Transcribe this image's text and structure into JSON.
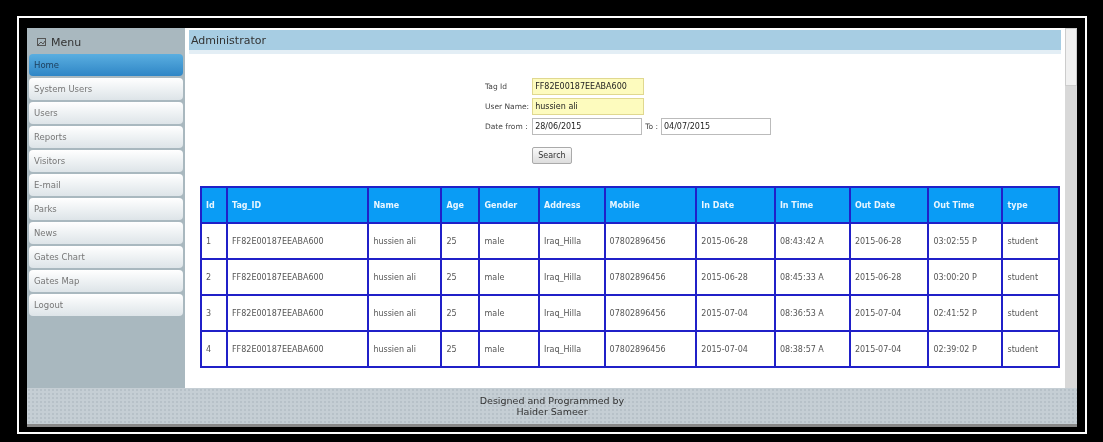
{
  "sidebar": {
    "title": "Menu",
    "items": [
      {
        "label": "Home",
        "selected": true
      },
      {
        "label": "System Users",
        "selected": false
      },
      {
        "label": "Users",
        "selected": false
      },
      {
        "label": "Reports",
        "selected": false
      },
      {
        "label": "Visitors",
        "selected": false
      },
      {
        "label": "E-mail",
        "selected": false
      },
      {
        "label": "Parks",
        "selected": false
      },
      {
        "label": "News",
        "selected": false
      },
      {
        "label": "Gates Chart",
        "selected": false
      },
      {
        "label": "Gates Map",
        "selected": false
      },
      {
        "label": "Logout",
        "selected": false
      }
    ]
  },
  "header": {
    "title": "Administrator"
  },
  "form": {
    "tag_id": {
      "label": "Tag Id",
      "value": "FF82E00187EEABA600"
    },
    "user_name": {
      "label": "User Name:",
      "value": "hussien ali"
    },
    "date_from": {
      "label": "Date from :",
      "value": "28/06/2015"
    },
    "date_to": {
      "label": "To :",
      "value": "04/07/2015"
    },
    "search_button": "Search"
  },
  "table": {
    "columns": [
      "Id",
      "Tag_ID",
      "Name",
      "Age",
      "Gender",
      "Address",
      "Mobile",
      "In Date",
      "In Time",
      "Out Date",
      "Out Time",
      "type"
    ],
    "rows": [
      [
        "1",
        "FF82E00187EEABA600",
        "hussien ali",
        "25",
        "male",
        "Iraq_Hilla",
        "07802896456",
        "2015-06-28",
        "08:43:42 A",
        "2015-06-28",
        "03:02:55 P",
        "student"
      ],
      [
        "2",
        "FF82E00187EEABA600",
        "hussien ali",
        "25",
        "male",
        "Iraq_Hilla",
        "07802896456",
        "2015-06-28",
        "08:45:33 A",
        "2015-06-28",
        "03:00:20 P",
        "student"
      ],
      [
        "3",
        "FF82E00187EEABA600",
        "hussien ali",
        "25",
        "male",
        "Iraq_Hilla",
        "07802896456",
        "2015-07-04",
        "08:36:53 A",
        "2015-07-04",
        "02:41:52 P",
        "student"
      ],
      [
        "4",
        "FF82E00187EEABA600",
        "hussien ali",
        "25",
        "male",
        "Iraq_Hilla",
        "07802896456",
        "2015-07-04",
        "08:38:57 A",
        "2015-07-04",
        "02:39:02 P",
        "student"
      ]
    ]
  },
  "footer": {
    "lines": [
      "Designed and Programmed by",
      "Haider Sameer"
    ]
  }
}
